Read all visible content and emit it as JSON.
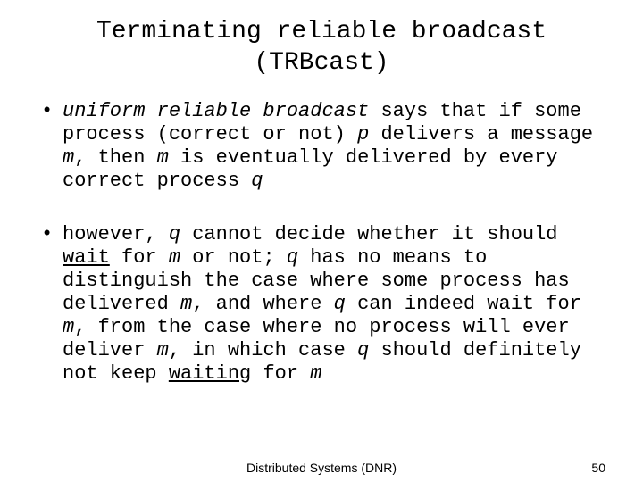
{
  "title_line1": "Terminating reliable broadcast",
  "title_line2": "(TRBcast)",
  "bullet1": {
    "lead_italic": "uniform reliable broadcast",
    "t1": " says that if some process (correct or not) ",
    "p": "p",
    "t2": " delivers a message ",
    "m1": "m",
    "t3": ", then ",
    "m2": "m",
    "t4": " is eventually delivered by every correct process ",
    "q": "q"
  },
  "bullet2": {
    "t1": "however, ",
    "q1": "q",
    "t2": " cannot decide whether it should ",
    "wait1": "wait",
    "t3": " for ",
    "m1": "m",
    "t4": " or not; ",
    "q2": "q",
    "t5": " has no means to distinguish the case where some process has delivered ",
    "m2": "m",
    "t6": ", and where ",
    "q3": "q",
    "t7": " can indeed wait for ",
    "m3": "m",
    "t8": ", from the case where no process will ever deliver ",
    "m4": "m",
    "t9": ", in which case ",
    "q4": "q",
    "t10": " should definitely not keep ",
    "wait2": "waiting",
    "t11": " for ",
    "m5": "m"
  },
  "footer_center": "Distributed Systems (DNR)",
  "footer_right": "50"
}
